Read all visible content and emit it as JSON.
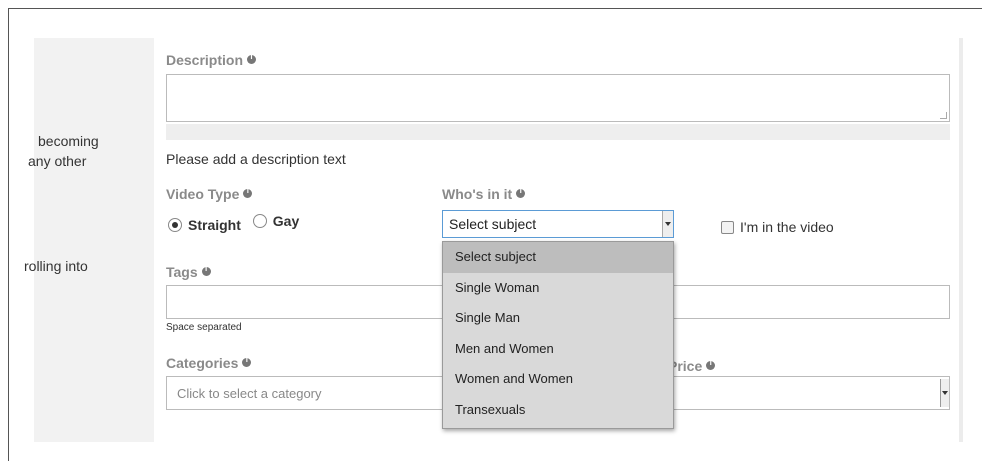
{
  "left_fragments": [
    "becoming",
    "any other",
    "rolling into"
  ],
  "description": {
    "label": "Description",
    "hint": "Please add a description text"
  },
  "video_type": {
    "label": "Video Type",
    "options": [
      "Straight",
      "Gay"
    ],
    "selected": "Straight"
  },
  "whos_in_it": {
    "label": "Who's in it",
    "selected": "Select subject",
    "options": [
      "Select subject",
      "Single Woman",
      "Single Man",
      "Men and Women",
      "Women and Women",
      "Transexuals"
    ]
  },
  "in_video_checkbox": {
    "label": "I'm in the video",
    "checked": false
  },
  "tags": {
    "label": "Tags",
    "helper": "Space separated"
  },
  "categories": {
    "label": "Categories",
    "placeholder": "Click to select a category"
  },
  "price": {
    "label": "Price"
  }
}
